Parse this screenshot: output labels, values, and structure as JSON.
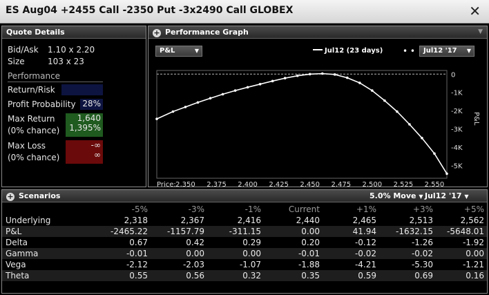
{
  "window": {
    "title": "ES Aug04  +2455 Call  -2350 Put  -3x2490 Call GLOBEX",
    "close_glyph": "✕"
  },
  "quote_details": {
    "header": "Quote Details",
    "bid_ask_label": "Bid/Ask",
    "bid_ask_value": "1.10 x 2.20",
    "size_label": "Size",
    "size_value": "103 x 23",
    "performance_label": "Performance",
    "return_risk_label": "Return/Risk",
    "return_risk_value": "",
    "profit_prob_label": "Profit Probability",
    "profit_prob_value": "28%",
    "max_return_label": "Max Return",
    "max_return_chance": "(0% chance)",
    "max_return_value": "1,640",
    "max_return_value2": "1,395%",
    "max_loss_label": "Max Loss",
    "max_loss_chance": "(0% chance)",
    "max_loss_value": "-∞",
    "max_loss_value2": "∞",
    "colors": {
      "return_risk": "#0d1440",
      "max_return": "#1f5a1f",
      "max_loss": "#6b0a0a"
    }
  },
  "performance_graph": {
    "header": "Performance Graph",
    "metric_dropdown": "P&L",
    "legend_series": "Jul12 (23 days)",
    "date_dropdown": "Jul12 '17",
    "price_label": "Price:"
  },
  "chart_data": {
    "type": "line",
    "xlabel": "Price:",
    "ylabel": "P&L",
    "x_ticks": [
      "2,350",
      "2,375",
      "2,400",
      "2,425",
      "2,450",
      "2,475",
      "2,500",
      "2,525",
      "2,550"
    ],
    "x_tick_values": [
      2350,
      2375,
      2400,
      2425,
      2450,
      2475,
      2500,
      2525,
      2550
    ],
    "y_ticks": [
      "0",
      "-1K",
      "-2K",
      "-3K",
      "-4K",
      "-5K"
    ],
    "y_tick_values": [
      0,
      -1000,
      -2000,
      -3000,
      -4000,
      -5000
    ],
    "xlim": [
      2327,
      2560
    ],
    "ylim": [
      -5700,
      200
    ],
    "grid": false,
    "legend": "top-right",
    "series": [
      {
        "name": "Jul12 (23 days)",
        "x": [
          2327,
          2340,
          2350,
          2360,
          2370,
          2380,
          2390,
          2400,
          2410,
          2420,
          2430,
          2440,
          2450,
          2460,
          2470,
          2480,
          2490,
          2500,
          2510,
          2520,
          2530,
          2540,
          2550,
          2560
        ],
        "y": [
          -2450,
          -2050,
          -1800,
          -1550,
          -1320,
          -1100,
          -900,
          -720,
          -550,
          -380,
          -220,
          -90,
          0,
          30,
          -20,
          -200,
          -480,
          -900,
          -1450,
          -2050,
          -2750,
          -3500,
          -4350,
          -5450
        ]
      }
    ],
    "colors": {
      "line": "#ffffff",
      "axis_bg": "#000000",
      "zero_line": "#bbbbbb"
    }
  },
  "scenarios": {
    "header": "Scenarios",
    "move_dropdown": "5.0% Move",
    "date_dropdown": "Jul12 '17",
    "columns": [
      "",
      "-5%",
      "-3%",
      "-1%",
      "Current",
      "+1%",
      "+3%",
      "+5%"
    ],
    "rows": [
      {
        "label": "Underlying",
        "values": [
          "2,318",
          "2,367",
          "2,416",
          "2,440",
          "2,465",
          "2,513",
          "2,562"
        ]
      },
      {
        "label": "P&L",
        "values": [
          "-2465.22",
          "-1157.79",
          "-311.15",
          "0.00",
          "41.94",
          "-1632.15",
          "-5648.01"
        ]
      },
      {
        "label": "Delta",
        "values": [
          "0.67",
          "0.42",
          "0.29",
          "0.20",
          "-0.12",
          "-1.26",
          "-1.92"
        ]
      },
      {
        "label": "Gamma",
        "values": [
          "-0.01",
          "0.00",
          "0.00",
          "-0.01",
          "-0.02",
          "-0.02",
          "0.00"
        ]
      },
      {
        "label": "Vega",
        "values": [
          "-2.12",
          "-2.03",
          "-1.07",
          "-1.88",
          "-4.21",
          "-5.30",
          "-1.21"
        ]
      },
      {
        "label": "Theta",
        "values": [
          "0.55",
          "0.56",
          "0.32",
          "0.35",
          "0.59",
          "0.69",
          "0.16"
        ]
      }
    ]
  }
}
